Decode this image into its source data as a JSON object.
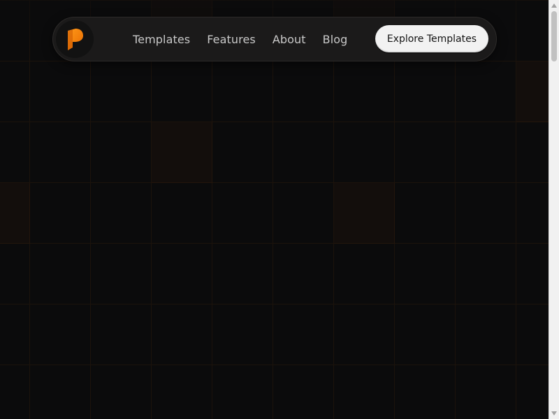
{
  "logo": {
    "icon": "p-logo-icon",
    "color": "#ff8a00"
  },
  "nav": {
    "links": [
      {
        "label": "Templates"
      },
      {
        "label": "Features"
      },
      {
        "label": "About"
      },
      {
        "label": "Blog"
      }
    ],
    "cta_label": "Explore Templates"
  },
  "colors": {
    "background": "#0b0b0c",
    "accent": "#ff8a00",
    "navbar": "#1b1a1a",
    "cta_bg": "#f2f2f2"
  },
  "scrollbar": {
    "position_fraction": 0.0
  }
}
